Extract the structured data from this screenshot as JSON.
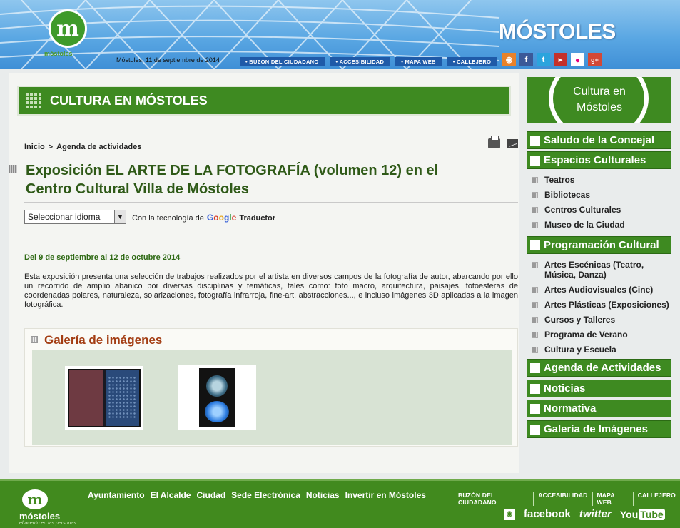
{
  "header": {
    "logo_mark": "m",
    "logo_text": "móstoles",
    "date": "Móstoles, 11 de septiembre de 2014",
    "brand": "MÓSTOLES",
    "top_links": [
      "• BUZÓN DEL CIUDADANO",
      "• ACCESIBILIDAD",
      "• MAPA WEB",
      "• CALLEJERO"
    ],
    "social_icons": [
      "rss-icon",
      "facebook-icon",
      "twitter-icon",
      "youtube-icon",
      "flickr-icon",
      "google-plus-icon"
    ]
  },
  "section": {
    "title": "CULTURA EN MÓSTOLES"
  },
  "breadcrumb": {
    "home": "Inicio",
    "sep": ">",
    "current": "Agenda de actividades"
  },
  "article": {
    "title": "Exposición EL ARTE DE LA FOTOGRAFÍA (volumen 12) en el Centro Cultural Villa de Móstoles",
    "language_select": "Seleccionar idioma",
    "powered_by": "Con la tecnología de",
    "google": [
      "G",
      "o",
      "o",
      "g",
      "l",
      "e"
    ],
    "translator": "Traductor",
    "date_range": "Del 9 de septiembre al 12 de octubre 2014",
    "description": "Esta exposición presenta una selección de trabajos realizados por el artista en diversos campos de la fotografía de autor, abarcando por ello un recorrido de amplio abanico por  diversas disciplinas y temáticas, tales como: foto macro, arquitectura, paisajes, fotoesferas de coordenadas polares, naturaleza, solarizaciones, fotografía infrarroja, fine-art, abstracciones..., e  incluso imágenes 3D aplicadas a la imagen fotográfica."
  },
  "gallery": {
    "title": "Galería de imágenes"
  },
  "sidebar": {
    "banner": "Cultura en Móstoles",
    "buttons": {
      "saludo": "Saludo de la Concejal",
      "espacios": "Espacios Culturales",
      "programacion": "Programación Cultural",
      "agenda": "Agenda de Actividades",
      "noticias": "Noticias",
      "normativa": "Normativa",
      "galeria": "Galería de Imágenes"
    },
    "espacios_items": [
      "Teatros",
      "Bibliotecas",
      "Centros Culturales",
      "Museo de la Ciudad"
    ],
    "programacion_items": [
      "Artes Escénicas (Teatro, Música, Danza)",
      "Artes Audiovisuales (Cine)",
      "Artes Plásticas (Exposiciones)",
      "Cursos y Talleres",
      "Programa de Verano",
      "Cultura y Escuela"
    ]
  },
  "footer": {
    "logo_mark": "m",
    "logo_text": "móstoles",
    "logo_sub": "el acento en las personas",
    "nav": [
      "Ayuntamiento",
      "El Alcalde",
      "Ciudad",
      "Sede Electrónica",
      "Noticias",
      "Invertir en Móstoles"
    ],
    "links": [
      "BUZÓN DEL CIUDADANO",
      "ACCESIBILIDAD",
      "MAPA WEB",
      "CALLEJERO"
    ],
    "social": {
      "facebook": "facebook",
      "twitter": "twitter",
      "youtube_a": "You",
      "youtube_b": "Tube"
    }
  }
}
